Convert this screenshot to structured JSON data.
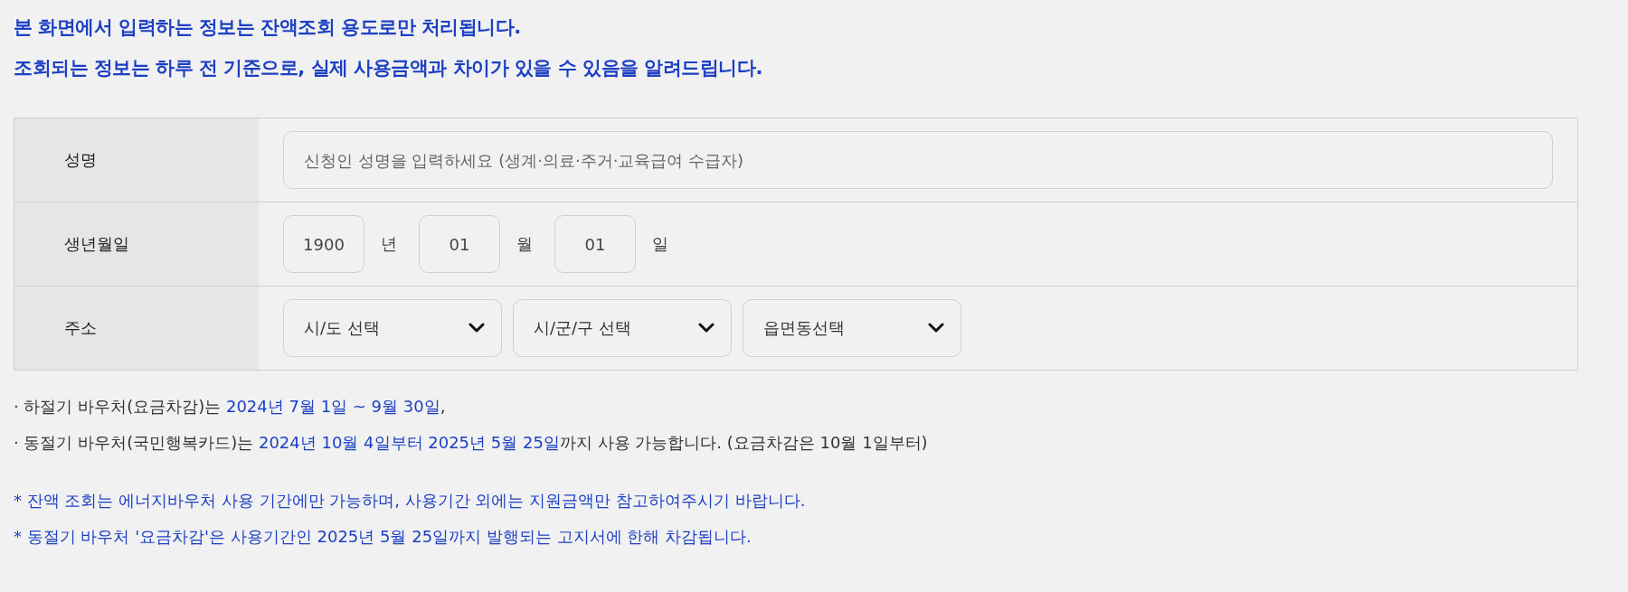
{
  "notice": [
    "본 화면에서 입력하는 정보는 잔액조회 용도로만 처리됩니다.",
    "조회되는 정보는 하루 전 기준으로, 실제 사용금액과 차이가 있을 수 있음을 알려드립니다."
  ],
  "form": {
    "name": {
      "label": "성명",
      "placeholder": "신청인 성명을 입력하세요 (생계·의료·주거·교육급여 수급자)"
    },
    "birth": {
      "label": "생년월일",
      "parts": [
        {
          "value": "1900",
          "unit": "년"
        },
        {
          "value": "01",
          "unit": "월"
        },
        {
          "value": "01",
          "unit": "일"
        }
      ]
    },
    "address": {
      "label": "주소",
      "selects": [
        {
          "value": "시/도 선택"
        },
        {
          "value": "시/군/구 선택"
        },
        {
          "value": "읍면동선택"
        }
      ]
    }
  },
  "periods": [
    {
      "segments": [
        {
          "kind": "plain",
          "text": "· 하절기 바우처(요금차감)는 "
        },
        {
          "kind": "highlight",
          "text": "2024년 7월 1일 ~ 9월 30일"
        },
        {
          "kind": "plain",
          "text": ","
        }
      ]
    },
    {
      "segments": [
        {
          "kind": "plain",
          "text": "· 동절기 바우처(국민행복카드)는 "
        },
        {
          "kind": "highlight",
          "text": "2024년 10월 4일부터 2025년 5월 25일"
        },
        {
          "kind": "plain",
          "text": "까지 사용 가능합니다. (요금차감은 10월 1일부터)"
        }
      ]
    }
  ],
  "remarks": [
    "* 잔액 조회는 에너지바우처 사용 기간에만 가능하며, 사용기간 외에는 지원금액만 참고하여주시기 바랍니다.",
    "* 동절기 바우처 '요금차감'은 사용기간인 2025년 5월 25일까지 발행되는 고지서에 한해 차감됩니다."
  ]
}
